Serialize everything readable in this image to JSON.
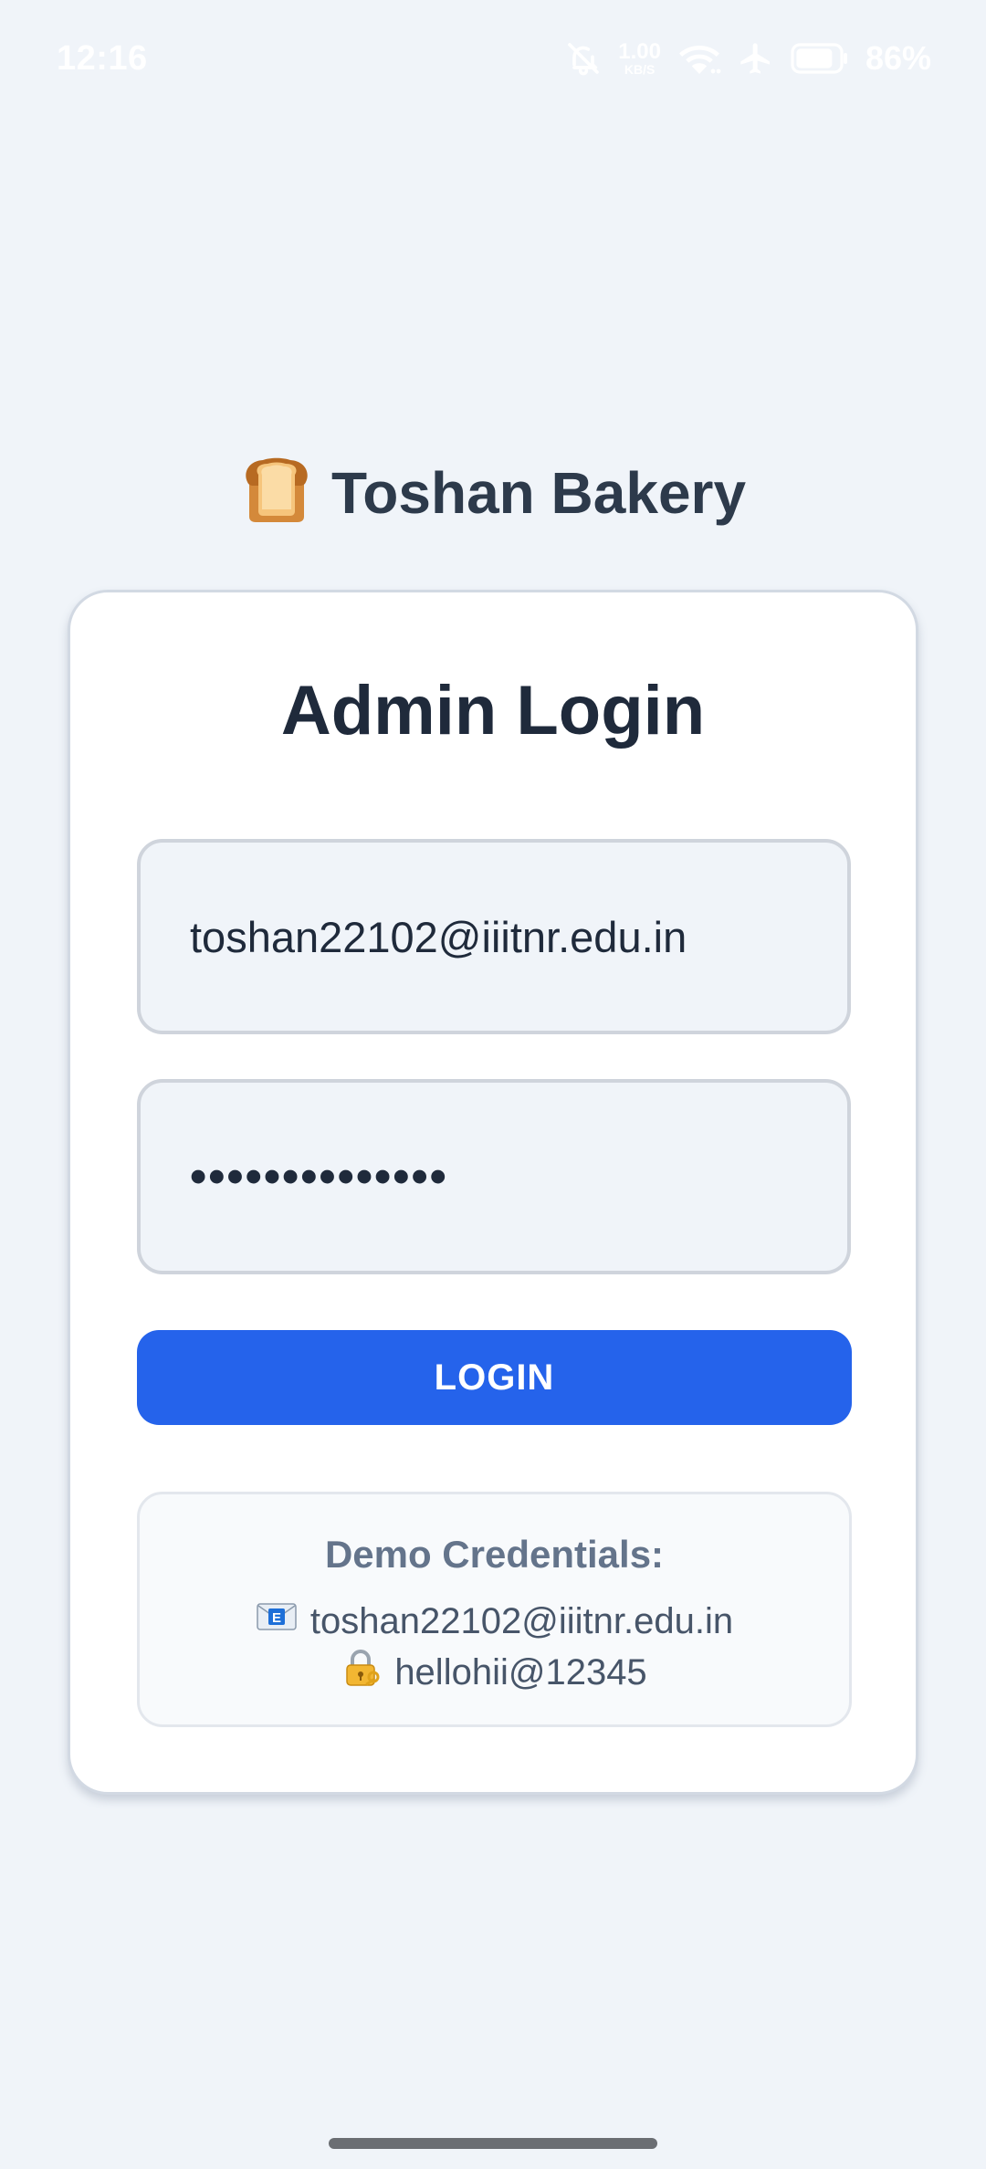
{
  "status_bar": {
    "time": "12:16",
    "network_speed_value": "1.00",
    "network_speed_unit": "KB/S",
    "battery": "86%",
    "icons": [
      "bell-off-icon",
      "wifi-icon",
      "airplane-icon",
      "battery-icon"
    ]
  },
  "brand": {
    "icon": "bread-icon",
    "title": "Toshan Bakery"
  },
  "login": {
    "heading": "Admin Login",
    "email_value": "toshan22102@iiitnr.edu.in",
    "password_mask": "••••••••••••••",
    "button_label": "LOGIN"
  },
  "demo": {
    "title": "Demo Credentials:",
    "email_icon": "envelope-e-icon",
    "email": "toshan22102@iiitnr.edu.in",
    "password_icon": "lock-key-icon",
    "password": "hellohii@12345"
  },
  "colors": {
    "background": "#f0f4f9",
    "primary": "#2563eb",
    "heading": "#1f2a3b",
    "brand_text": "#2d3a4b",
    "muted": "#64748b"
  }
}
